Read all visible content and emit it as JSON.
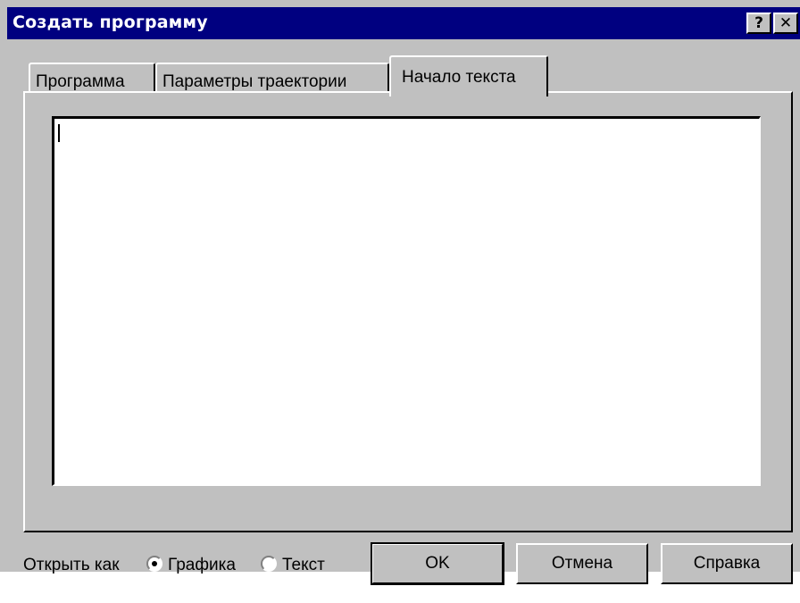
{
  "window": {
    "title": "Создать программу",
    "help_glyph": "?",
    "close_glyph": "✕"
  },
  "tabs": [
    {
      "label": "Программа",
      "selected": false
    },
    {
      "label": "Параметры траектории",
      "selected": false
    },
    {
      "label": "Начало текста",
      "selected": true
    }
  ],
  "editor": {
    "value": ""
  },
  "open_as": {
    "label": "Открыть как",
    "options": [
      {
        "label": "Графика",
        "selected": true
      },
      {
        "label": "Текст",
        "selected": false
      }
    ]
  },
  "buttons": {
    "ok": "OK",
    "cancel": "Отмена",
    "help": "Справка"
  },
  "colors": {
    "titlebar": "#000080",
    "face": "#c0c0c0"
  }
}
